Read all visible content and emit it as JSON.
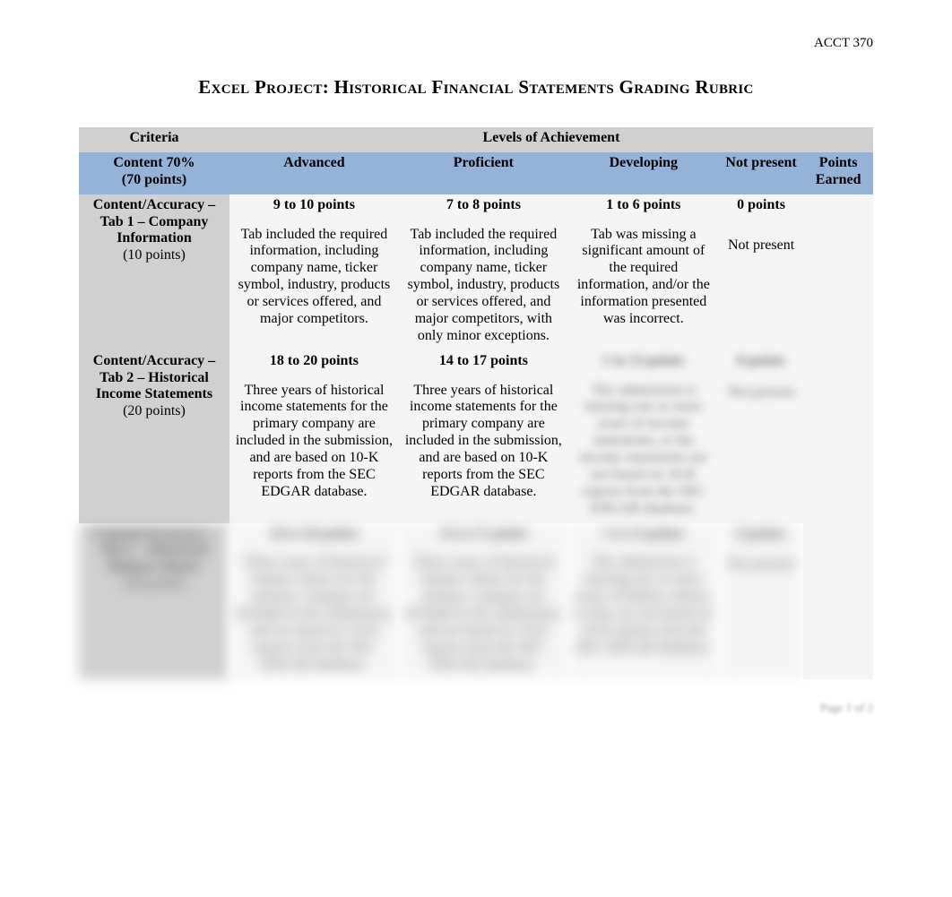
{
  "course_code": "ACCT 370",
  "title": "Excel Project: Historical Financial Statements Grading Rubric",
  "headers": {
    "criteria": "Criteria",
    "levels": "Levels of Achievement",
    "content_pct": "Content 70%",
    "content_pts": "(70 points)",
    "advanced": "Advanced",
    "proficient": "Proficient",
    "developing": "Developing",
    "not_present": "Not present",
    "points_earned": "Points Earned"
  },
  "rows": [
    {
      "criteria_title": "Content/Accuracy – Tab 1 – Company Information",
      "criteria_points": "(10 points)",
      "advanced": {
        "points": "9 to 10 points",
        "desc": "Tab included the required information, including company name, ticker symbol, industry, products or services offered, and major competitors."
      },
      "proficient": {
        "points": "7 to 8 points",
        "desc": "Tab included the required information, including company name, ticker symbol, industry, products or services offered, and major competitors, with only minor exceptions."
      },
      "developing": {
        "points": "1 to 6 points",
        "desc": "Tab was missing a significant amount of the required information, and/or the information presented was incorrect."
      },
      "not_present": {
        "points": "0 points",
        "desc": "Not present"
      }
    },
    {
      "criteria_title": "Content/Accuracy – Tab 2 – Historical Income Statements",
      "criteria_points": "(20 points)",
      "advanced": {
        "points": "18 to 20 points",
        "desc": "Three years of historical income statements for the primary company are included in the submission, and are based on 10-K reports from the SEC EDGAR database."
      },
      "proficient": {
        "points": "14 to 17 points",
        "desc": "Three years of historical income statements for the primary company are included in the submission, and are based on 10-K reports from the SEC EDGAR database."
      },
      "developing": {
        "points": "1 to 13 points",
        "desc": "The submission is missing one or more years of income statements, or the income statements are not based on 10-K reports from the SEC EDGAR database."
      },
      "not_present": {
        "points": "0 points",
        "desc": "Not present"
      }
    },
    {
      "criteria_title": "Content/Accuracy – Tab 3 – Historical Balance Sheets",
      "criteria_points": "(20 points)",
      "advanced": {
        "points": "18 to 20 points",
        "desc": "Three years of historical balance sheets for the primary company are included in the submission, and are based on 10-K reports from the SEC EDGAR database."
      },
      "proficient": {
        "points": "14 to 17 points",
        "desc": "Three years of historical balance sheets for the primary company are included in the submission, and are based on 10-K reports from the SEC EDGAR database."
      },
      "developing": {
        "points": "1 to 13 points",
        "desc": "The submission is missing one or more years of balance sheets, or they are not based on 10-K reports from the SEC EDGAR database."
      },
      "not_present": {
        "points": "0 points",
        "desc": "Not present"
      }
    }
  ],
  "footer": "Page 1 of 2"
}
